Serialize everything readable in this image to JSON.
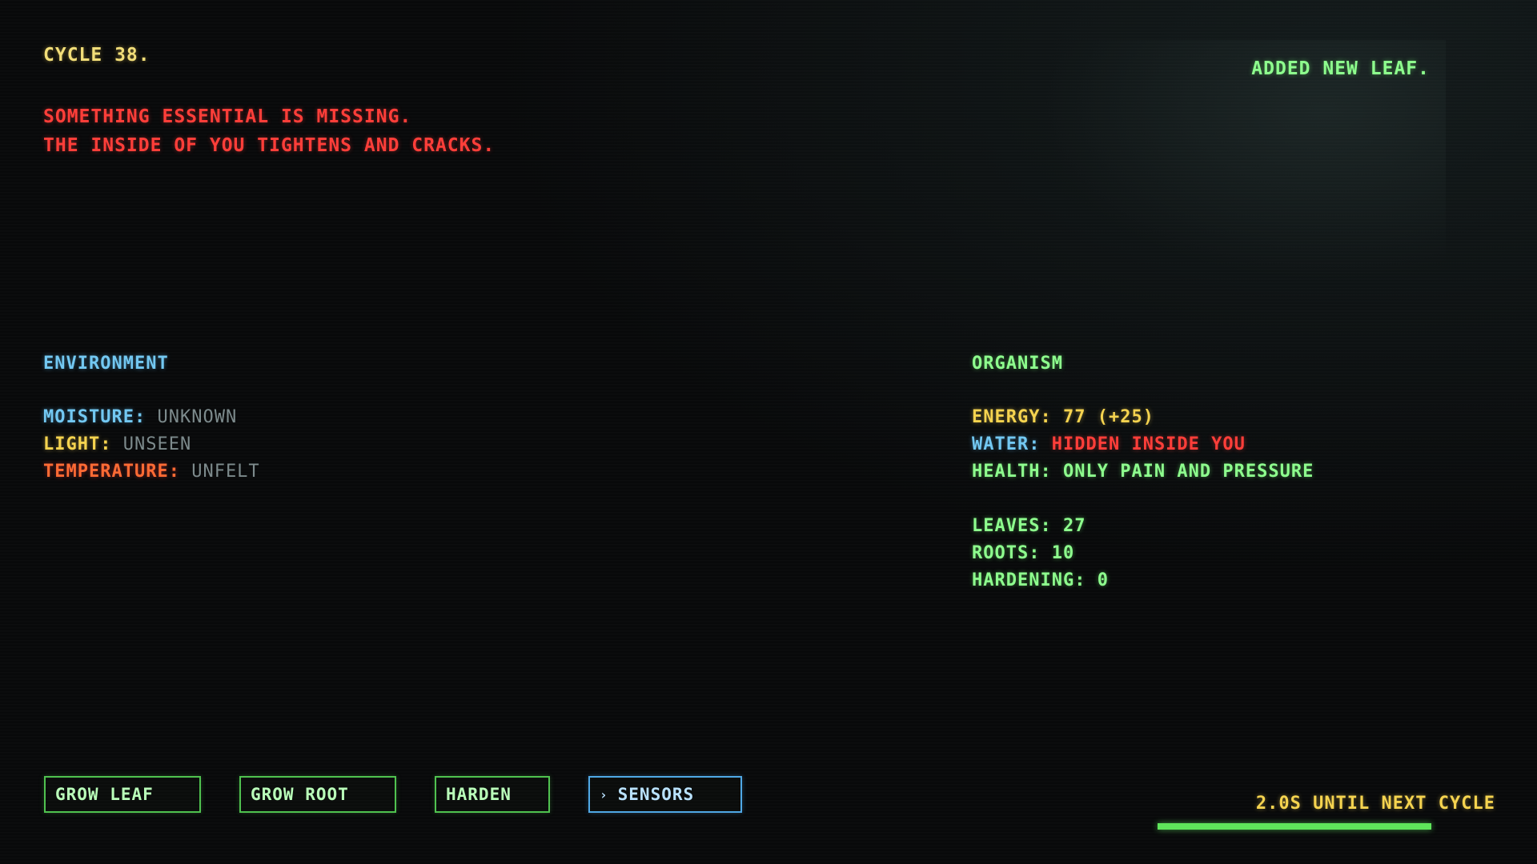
{
  "header": {
    "cycle_title": "CYCLE 38.",
    "story_lines": [
      "SOMETHING ESSENTIAL IS MISSING.",
      "THE INSIDE OF YOU TIGHTENS AND CRACKS."
    ],
    "notice": "ADDED NEW LEAF."
  },
  "environment": {
    "title": "ENVIRONMENT",
    "moisture": {
      "label": "MOISTURE:",
      "value": "UNKNOWN"
    },
    "light": {
      "label": "LIGHT:",
      "value": "UNSEEN"
    },
    "temperature": {
      "label": "TEMPERATURE:",
      "value": "UNFELT"
    }
  },
  "organism": {
    "title": "ORGANISM",
    "energy": {
      "label": "ENERGY:",
      "value": "77 (+25)"
    },
    "water": {
      "label": "WATER:",
      "value": "HIDDEN INSIDE YOU"
    },
    "health": {
      "label": "HEALTH:",
      "value": "ONLY PAIN AND PRESSURE"
    },
    "leaves": {
      "label": "LEAVES:",
      "value": "27"
    },
    "roots": {
      "label": "ROOTS:",
      "value": "10"
    },
    "hardening": {
      "label": "HARDENING:",
      "value": "0"
    }
  },
  "actions": {
    "grow_leaf": "GROW LEAF",
    "grow_root": "GROW ROOT",
    "harden": "HARDEN",
    "sensors_chevron": "›",
    "sensors": "SENSORS"
  },
  "timer": {
    "text": "2.0S UNTIL NEXT CYCLE",
    "progress": 1.0
  },
  "colors": {
    "background": "#08090a",
    "green": "#8dff8d",
    "red": "#ff3d38",
    "yellow": "#f5d34e",
    "cyan": "#72c8f2",
    "orange": "#ff6a33",
    "gray": "#7c8a8c",
    "progress": "#5ee65a"
  }
}
